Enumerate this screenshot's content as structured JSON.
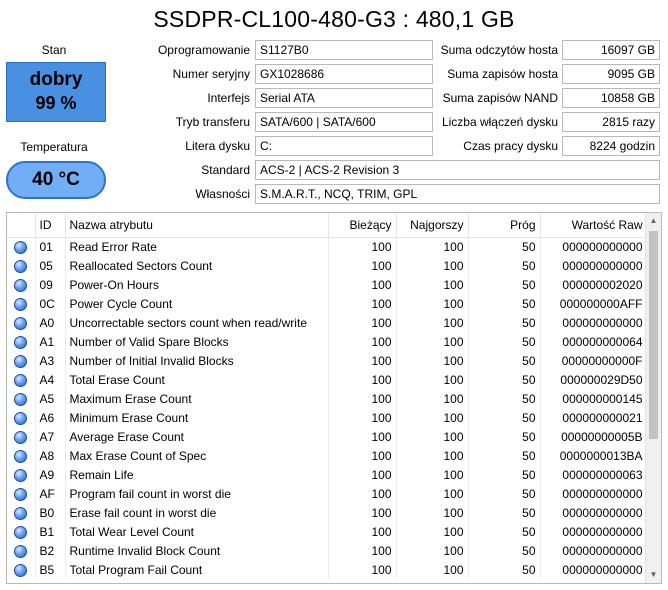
{
  "title": "SSDPR-CL100-480-G3 : 480,1 GB",
  "status": {
    "stan_label": "Stan",
    "health_word": "dobry",
    "health_pct": "99 %",
    "health_color": "#4a90e2",
    "temp_label": "Temperatura",
    "temp_value": "40 °C",
    "temp_color": "#72aef5"
  },
  "info": {
    "firmware_label": "Oprogramowanie",
    "firmware": "S1127B0",
    "serial_label": "Numer seryjny",
    "serial": "GX1028686",
    "interface_label": "Interfejs",
    "interface": "Serial ATA",
    "transfer_label": "Tryb transferu",
    "transfer": "SATA/600 | SATA/600",
    "drive_letter_label": "Litera dysku",
    "drive_letter": "C:",
    "standard_label": "Standard",
    "standard": "ACS-2 | ACS-2 Revision 3",
    "features_label": "Własności",
    "features": "S.M.A.R.T., NCQ, TRIM, GPL"
  },
  "stats": {
    "host_reads_label": "Suma odczytów hosta",
    "host_reads": "16097 GB",
    "host_writes_label": "Suma zapisów hosta",
    "host_writes": "9095 GB",
    "nand_writes_label": "Suma zapisów NAND",
    "nand_writes": "10858 GB",
    "power_on_count_label": "Liczba włączeń dysku",
    "power_on_count": "2815 razy",
    "power_on_hours_label": "Czas pracy dysku",
    "power_on_hours": "8224 godzin"
  },
  "table": {
    "headers": {
      "id": "ID",
      "name": "Nazwa atrybutu",
      "current": "Bieżący",
      "worst": "Najgorszy",
      "threshold": "Próg",
      "raw": "Wartość Raw"
    },
    "rows": [
      {
        "id": "01",
        "name": "Read Error Rate",
        "current": "100",
        "worst": "100",
        "threshold": "50",
        "raw": "000000000000"
      },
      {
        "id": "05",
        "name": "Reallocated Sectors Count",
        "current": "100",
        "worst": "100",
        "threshold": "50",
        "raw": "000000000000"
      },
      {
        "id": "09",
        "name": "Power-On Hours",
        "current": "100",
        "worst": "100",
        "threshold": "50",
        "raw": "000000002020"
      },
      {
        "id": "0C",
        "name": "Power Cycle Count",
        "current": "100",
        "worst": "100",
        "threshold": "50",
        "raw": "000000000AFF"
      },
      {
        "id": "A0",
        "name": "Uncorrectable sectors count when read/write",
        "current": "100",
        "worst": "100",
        "threshold": "50",
        "raw": "000000000000"
      },
      {
        "id": "A1",
        "name": "Number of Valid Spare Blocks",
        "current": "100",
        "worst": "100",
        "threshold": "50",
        "raw": "000000000064"
      },
      {
        "id": "A3",
        "name": "Number of Initial Invalid Blocks",
        "current": "100",
        "worst": "100",
        "threshold": "50",
        "raw": "00000000000F"
      },
      {
        "id": "A4",
        "name": "Total Erase Count",
        "current": "100",
        "worst": "100",
        "threshold": "50",
        "raw": "000000029D50"
      },
      {
        "id": "A5",
        "name": "Maximum Erase Count",
        "current": "100",
        "worst": "100",
        "threshold": "50",
        "raw": "000000000145"
      },
      {
        "id": "A6",
        "name": "Minimum Erase Count",
        "current": "100",
        "worst": "100",
        "threshold": "50",
        "raw": "000000000021"
      },
      {
        "id": "A7",
        "name": "Average Erase Count",
        "current": "100",
        "worst": "100",
        "threshold": "50",
        "raw": "00000000005B"
      },
      {
        "id": "A8",
        "name": "Max Erase Count of Spec",
        "current": "100",
        "worst": "100",
        "threshold": "50",
        "raw": "0000000013BA"
      },
      {
        "id": "A9",
        "name": "Remain Life",
        "current": "100",
        "worst": "100",
        "threshold": "50",
        "raw": "000000000063"
      },
      {
        "id": "AF",
        "name": "Program fail count in worst die",
        "current": "100",
        "worst": "100",
        "threshold": "50",
        "raw": "000000000000"
      },
      {
        "id": "B0",
        "name": "Erase fail count in worst die",
        "current": "100",
        "worst": "100",
        "threshold": "50",
        "raw": "000000000000"
      },
      {
        "id": "B1",
        "name": "Total Wear Level Count",
        "current": "100",
        "worst": "100",
        "threshold": "50",
        "raw": "000000000000"
      },
      {
        "id": "B2",
        "name": "Runtime Invalid Block Count",
        "current": "100",
        "worst": "100",
        "threshold": "50",
        "raw": "000000000000"
      },
      {
        "id": "B5",
        "name": "Total Program Fail Count",
        "current": "100",
        "worst": "100",
        "threshold": "50",
        "raw": "000000000000"
      }
    ]
  },
  "icons": {
    "status_dot": "status-dot-icon",
    "scroll_up": "scroll-up-arrow-icon",
    "scroll_down": "scroll-down-arrow-icon"
  }
}
